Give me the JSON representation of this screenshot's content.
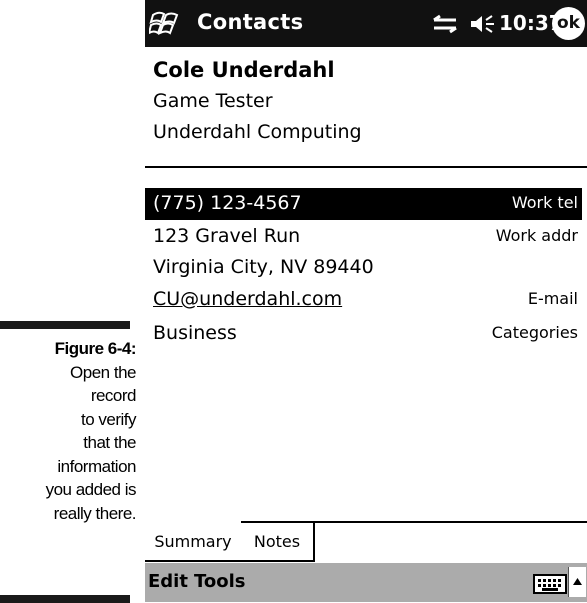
{
  "caption": {
    "label": "Figure 6-4:",
    "lines": [
      "Open the",
      "record",
      "to verify",
      "that the",
      "information",
      "you added is",
      "really there."
    ]
  },
  "titlebar": {
    "app_title": "Contacts",
    "time": "10:37",
    "ok_label": "ok",
    "icons": [
      "windows-start-icon",
      "connectivity-icon",
      "speaker-icon"
    ]
  },
  "contact": {
    "name": "Cole Underdahl",
    "title": "Game Tester",
    "company": "Underdahl Computing"
  },
  "fields": [
    {
      "value": "(775) 123-4567",
      "label": "Work tel",
      "selected": true
    },
    {
      "value": "123 Gravel Run",
      "label": "Work addr"
    },
    {
      "value": "Virginia City, NV 89440",
      "label": ""
    },
    {
      "value": "CU@underdahl.com",
      "label": "E-mail"
    },
    {
      "value": "Business",
      "label": "Categories"
    }
  ],
  "tabs": [
    {
      "label": "Summary",
      "active": true
    },
    {
      "label": "Notes",
      "active": false
    }
  ],
  "menubar": {
    "items": [
      "Edit",
      "Tools"
    ],
    "icons": [
      "keyboard-icon",
      "input-arrow-icon"
    ]
  },
  "colors": {
    "titlebar_bg": "#111111",
    "menubar_bg": "#ababab",
    "selection_bg": "#000000"
  }
}
